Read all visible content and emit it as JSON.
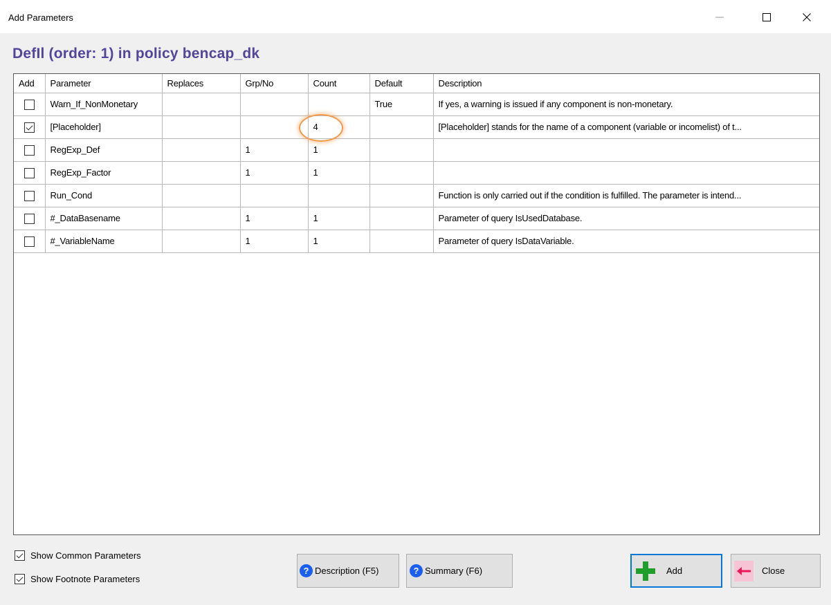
{
  "window": {
    "title": "Add Parameters",
    "minimize_glyph": "—",
    "maximize_glyph": "☐",
    "close_glyph": "✕"
  },
  "heading": "DefIl (order: 1) in policy bencap_dk",
  "table": {
    "columns": [
      "Add",
      "Parameter",
      "Replaces",
      "Grp/No",
      "Count",
      "Default",
      "Description"
    ],
    "rows": [
      {
        "checked": false,
        "parameter": "Warn_If_NonMonetary",
        "replaces": "",
        "grp": "",
        "count": "",
        "default": "True",
        "description": "If yes, a warning is issued if any component is non-monetary."
      },
      {
        "checked": true,
        "parameter": "[Placeholder]",
        "replaces": "",
        "grp": "",
        "count": "4",
        "default": "",
        "description": "[Placeholder] stands for the name of a component (variable or incomelist) of t..."
      },
      {
        "checked": false,
        "parameter": "RegExp_Def",
        "replaces": "",
        "grp": "1",
        "count": "1",
        "default": "",
        "description": ""
      },
      {
        "checked": false,
        "parameter": "RegExp_Factor",
        "replaces": "",
        "grp": "1",
        "count": "1",
        "default": "",
        "description": ""
      },
      {
        "checked": false,
        "parameter": "Run_Cond",
        "replaces": "",
        "grp": "",
        "count": "",
        "default": "",
        "description": "Function is only carried out if the condition is fulfilled. The parameter is intend..."
      },
      {
        "checked": false,
        "parameter": "#_DataBasename",
        "replaces": "",
        "grp": "1",
        "count": "1",
        "default": "",
        "description": "Parameter of query IsUsedDatabase."
      },
      {
        "checked": false,
        "parameter": "#_VariableName",
        "replaces": "",
        "grp": "1",
        "count": "1",
        "default": "",
        "description": "Parameter of query IsDataVariable."
      }
    ]
  },
  "options": {
    "show_common": {
      "label": "Show Common Parameters",
      "checked": true
    },
    "show_footnote": {
      "label": "Show Footnote Parameters",
      "checked": true
    }
  },
  "buttons": {
    "description": "Description (F5)",
    "summary": "Summary (F6)",
    "add": "Add",
    "close": "Close"
  },
  "icons": {
    "help": "help-circle-icon",
    "add": "green-plus-icon",
    "close": "red-arrow-left-icon"
  },
  "colors": {
    "heading": "#52459a",
    "highlight": "#f29a4a",
    "help": "#1a5ff0",
    "add_plus": "#1f9e2c",
    "close_arrow": "#e8185a",
    "focus": "#0078d7"
  }
}
